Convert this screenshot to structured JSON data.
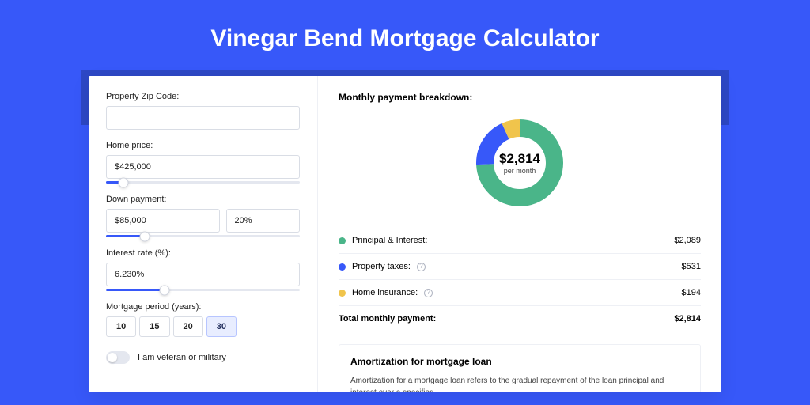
{
  "pageTitle": "Vinegar Bend Mortgage Calculator",
  "form": {
    "zip": {
      "label": "Property Zip Code:",
      "value": ""
    },
    "price": {
      "label": "Home price:",
      "value": "$425,000",
      "sliderPct": 9
    },
    "down": {
      "label": "Down payment:",
      "value": "$85,000",
      "pct": "20%",
      "sliderPct": 20
    },
    "rate": {
      "label": "Interest rate (%):",
      "value": "6.230%",
      "sliderPct": 30
    },
    "period": {
      "label": "Mortgage period (years):",
      "options": [
        "10",
        "15",
        "20",
        "30"
      ],
      "selected": "30"
    },
    "veteran": {
      "label": "I am veteran or military",
      "value": false
    }
  },
  "breakdown": {
    "heading": "Monthly payment breakdown:",
    "center": {
      "amount": "$2,814",
      "sub": "per month"
    },
    "items": [
      {
        "key": "pi",
        "label": "Principal & Interest:",
        "value": "$2,089",
        "color": "green",
        "info": false
      },
      {
        "key": "tax",
        "label": "Property taxes:",
        "value": "$531",
        "color": "blue",
        "info": true
      },
      {
        "key": "ins",
        "label": "Home insurance:",
        "value": "$194",
        "color": "yellow",
        "info": true
      }
    ],
    "total": {
      "label": "Total monthly payment:",
      "value": "$2,814"
    }
  },
  "amort": {
    "heading": "Amortization for mortgage loan",
    "text": "Amortization for a mortgage loan refers to the gradual repayment of the loan principal and interest over a specified"
  },
  "chart_data": {
    "type": "pie",
    "title": "Monthly payment breakdown",
    "series": [
      {
        "name": "Principal & Interest",
        "value": 2089,
        "color": "#4ab589"
      },
      {
        "name": "Property taxes",
        "value": 531,
        "color": "#3758f9"
      },
      {
        "name": "Home insurance",
        "value": 194,
        "color": "#f0c44c"
      }
    ],
    "total": 2814,
    "center_label": "$2,814 per month"
  }
}
